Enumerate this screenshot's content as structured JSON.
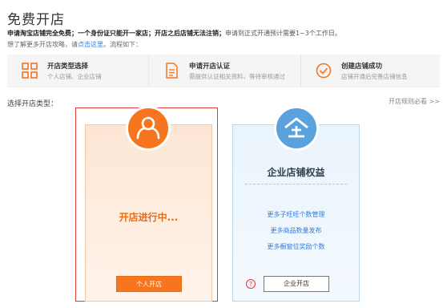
{
  "page": {
    "title": "免费开店",
    "intro_bold": "申请淘宝店铺完全免费；一个身份证只能开一家店；开店之后店铺无法注销；",
    "intro_rest": "申请到正式开通预计需要1~3个工作日。",
    "guide_prefix": "想了解更多开店攻略，请",
    "guide_link": "点击这里",
    "guide_suffix": "。流程如下："
  },
  "steps": [
    {
      "title": "开店类型选择",
      "subtitle": "个人店铺、企业店铺",
      "icon": "grid-icon"
    },
    {
      "title": "申请开店认证",
      "subtitle": "需提供认证相关资料，等待审核通过",
      "icon": "document-icon"
    },
    {
      "title": "创建店铺成功",
      "subtitle": "店铺开通后完善店铺信息",
      "icon": "check-circle-icon"
    }
  ],
  "select": {
    "heading": "选择开店类型：",
    "rules_link": "开店规则必看 >>"
  },
  "personal": {
    "status": "开店进行中...",
    "button": "个人开店",
    "icon": "person-icon",
    "accent": "#f7751e"
  },
  "enterprise": {
    "title": "企业店铺权益",
    "benefits": [
      "更多子旺旺个数管理",
      "更多商品数量发布",
      "更多橱窗位奖励个数"
    ],
    "button": "企业开店",
    "help": "?",
    "icon": "building-icon",
    "accent": "#5aa2dd"
  }
}
